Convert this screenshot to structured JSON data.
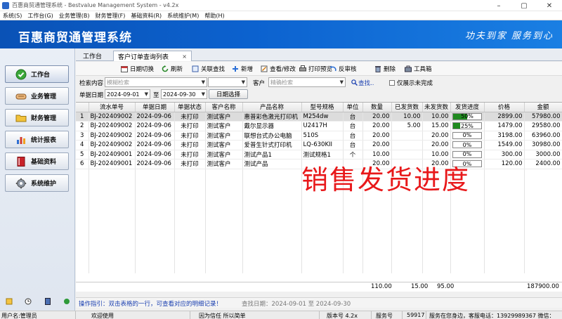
{
  "window": {
    "title": "百惠商贸通管理系统 - Bestvalue Management System - v4.2x"
  },
  "menu": [
    "系统(S)",
    "工作台(G)",
    "业务管理(B)",
    "财务管理(F)",
    "基础资料(R)",
    "系统维护(M)",
    "帮助(H)"
  ],
  "banner": {
    "system_name": "百惠商贸通管理系统",
    "slogan": "功夫到家 服务到心"
  },
  "sidebar": {
    "items": [
      {
        "label": "工作台",
        "icon": "check-icon"
      },
      {
        "label": "业务管理",
        "icon": "handshake-icon"
      },
      {
        "label": "财务管理",
        "icon": "folder-icon"
      },
      {
        "label": "统计报表",
        "icon": "bar-chart-icon"
      },
      {
        "label": "基础资料",
        "icon": "book-icon"
      },
      {
        "label": "系统维护",
        "icon": "gear-icon"
      }
    ]
  },
  "tabs": {
    "home": "工作台",
    "active": "客户订单查询列表",
    "close": "×"
  },
  "toolbar": {
    "date_switch": "日期切换",
    "refresh": "刷新",
    "related_search": "关联查找",
    "add": "新增",
    "view_edit": "查看/修改",
    "print_preview": "打印预览",
    "reverse_audit": "反审核",
    "delete": "删除",
    "toolbox": "工具箱"
  },
  "filters": {
    "search_label": "检索内容",
    "fuzzy_placeholder": "模糊检索",
    "customer_label": "客户",
    "exact_placeholder": "精确检索",
    "search_link": "查找..",
    "only_unfinished": "仅展示未完成",
    "date_label": "单据日期",
    "date_from": "2024-09-01",
    "date_to_sep": "至",
    "date_to": "2024-09-30",
    "date_select": "日期选择"
  },
  "table": {
    "headers": [
      "",
      "流水单号",
      "单据日期",
      "单据状态",
      "客户名称",
      "产品名称",
      "型号规格",
      "单位",
      "数量",
      "已发货数",
      "未发货数",
      "发货进度",
      "价格",
      "金额"
    ],
    "rows": [
      {
        "idx": "1",
        "no": "BJ-202409002",
        "date": "2024-09-06",
        "status": "未打印",
        "customer": "测试客户",
        "product": "惠普彩色激光打印机",
        "model": "M254dw",
        "unit": "台",
        "qty": "20.00",
        "shipped": "10.00",
        "unshipped": "10.00",
        "progress_label": "50%",
        "progress": 0.5,
        "price": "2899.00",
        "amount": "57980.00",
        "selected": true
      },
      {
        "idx": "2",
        "no": "BJ-202409002",
        "date": "2024-09-06",
        "status": "未打印",
        "customer": "测试客户",
        "product": "戴尔显示器",
        "model": "U2417H",
        "unit": "台",
        "qty": "20.00",
        "shipped": "5.00",
        "unshipped": "15.00",
        "progress_label": "25%",
        "progress": 0.25,
        "price": "1479.00",
        "amount": "29580.00",
        "selected": false
      },
      {
        "idx": "3",
        "no": "BJ-202409002",
        "date": "2024-09-06",
        "status": "未打印",
        "customer": "测试客户",
        "product": "联想台式办公电脑",
        "model": "510S",
        "unit": "台",
        "qty": "20.00",
        "shipped": "",
        "unshipped": "20.00",
        "progress_label": "0%",
        "progress": 0,
        "price": "3198.00",
        "amount": "63960.00",
        "selected": false
      },
      {
        "idx": "4",
        "no": "BJ-202409002",
        "date": "2024-09-06",
        "status": "未打印",
        "customer": "测试客户",
        "product": "爱普生针式打印机",
        "model": "LQ-630KII",
        "unit": "台",
        "qty": "20.00",
        "shipped": "",
        "unshipped": "20.00",
        "progress_label": "0%",
        "progress": 0,
        "price": "1549.00",
        "amount": "30980.00",
        "selected": false
      },
      {
        "idx": "5",
        "no": "BJ-202409001",
        "date": "2024-09-06",
        "status": "未打印",
        "customer": "测试客户",
        "product": "测试产品1",
        "model": "测试规格1",
        "unit": "个",
        "qty": "10.00",
        "shipped": "",
        "unshipped": "10.00",
        "progress_label": "0%",
        "progress": 0,
        "price": "300.00",
        "amount": "3000.00",
        "selected": false
      },
      {
        "idx": "6",
        "no": "BJ-202409001",
        "date": "2024-09-06",
        "status": "未打印",
        "customer": "测试客户",
        "product": "测试产品",
        "model": "",
        "unit": "",
        "qty": "20.00",
        "shipped": "",
        "unshipped": "20.00",
        "progress_label": "0%",
        "progress": 0,
        "price": "120.00",
        "amount": "2400.00",
        "selected": false
      }
    ]
  },
  "overlay_caption": "销售发货进度",
  "totals": {
    "qty": "110.00",
    "shipped": "15.00",
    "unshipped": "95.00",
    "amount": "187900.00"
  },
  "hint": {
    "text": "操作指引：双击表格的一行，可查看对应的明细记录！",
    "query_date": "查找日期：2024-09-01 至 2024-09-30"
  },
  "status": {
    "user": "用户名:管理员",
    "welcome": "欢迎使用",
    "motto": "因为信任 所以简单",
    "version": "版本号 4.2x",
    "service_label": "服务号",
    "service_no": "59917",
    "tagline": "服务在您身边，客服电话：13929989367 微信："
  },
  "colors": {
    "banner": "#0c62cf",
    "progress_fill": "#1f8a1f",
    "overlay": "#e8181a",
    "hint": "#1a3fb0"
  }
}
